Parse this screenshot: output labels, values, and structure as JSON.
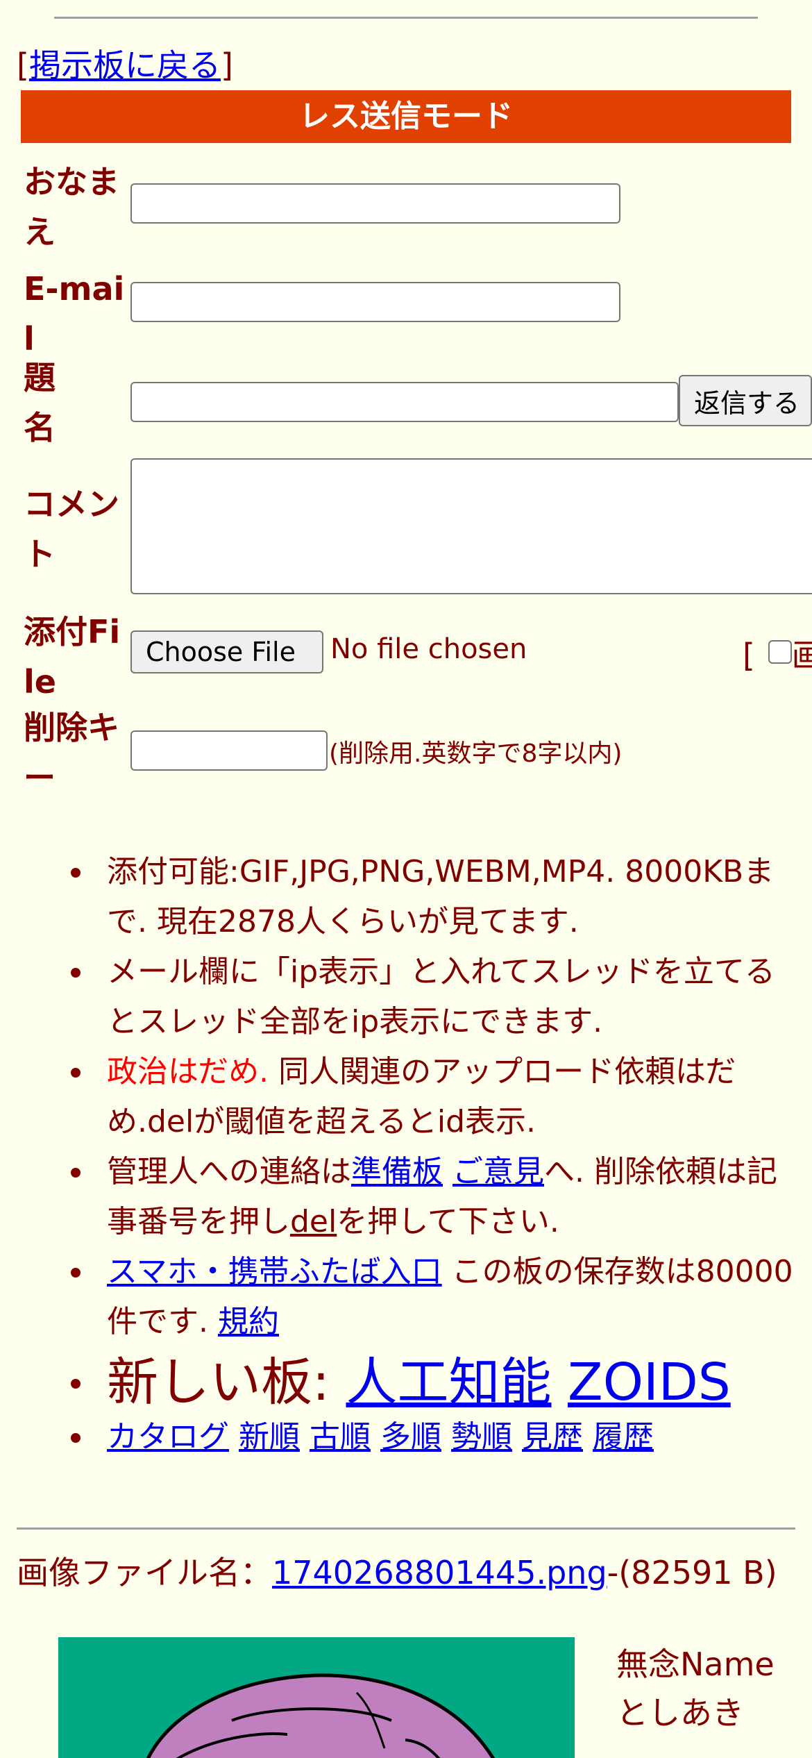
{
  "nav": {
    "back_link": "掲示板に戻る"
  },
  "form": {
    "mode_title": "レス送信モード",
    "labels": {
      "name": "おなまえ",
      "email": "E-mail",
      "subject": "題名",
      "comment": "コメント",
      "attach": "添付File",
      "delkey": "削除キー"
    },
    "reply_button": "返信する",
    "choose_file_button": "Choose File",
    "no_file_text": "No file chosen",
    "image_option_bracket": "[",
    "image_option_char": "画",
    "delkey_note": "(削除用.英数字で8字以内)"
  },
  "rules": {
    "r1": "添付可能:GIF,JPG,PNG,WEBM,MP4. 8000KBまで. 現在2878人くらいが見てます.",
    "r2": "メール欄に「ip表示」と入れてスレッドを立てるとスレッド全部をip表示にできます.",
    "r3_red": "政治はだめ.",
    "r3_rest": " 同人関連のアップロード依頼はだめ.delが閾値を超えるとid表示.",
    "r4_a": "管理人への連絡は",
    "r4_link1": "準備板",
    "r4_link2": "ご意見",
    "r4_b": "へ. 削除依頼は記事番号を押し",
    "r4_link3": "del",
    "r4_c": "を押して下さい.",
    "r5_link": "スマホ・携帯ふたば入口",
    "r5_text": " この板の保存数は80000件です. ",
    "r5_link2": "規約",
    "new_boards_label": "新しい板: ",
    "new_board_1": "人工知能",
    "new_board_2": "ZOIDS",
    "sort_links": [
      "カタログ",
      "新順",
      "古順",
      "多順",
      "勢順",
      "見歴",
      "履歴"
    ]
  },
  "post": {
    "file_label": "画像ファイル名：",
    "file_name": "1740268801445.png",
    "file_size": "-(82591 B)",
    "poster_name": "無念Name",
    "poster_name2": "としあき"
  },
  "colors": {
    "page_bg": "#ffffee",
    "text": "#800000",
    "mode_bar": "#e04000",
    "link": "#0000ee",
    "warning": "#ff0000",
    "thumb_bg": "#00a884"
  }
}
